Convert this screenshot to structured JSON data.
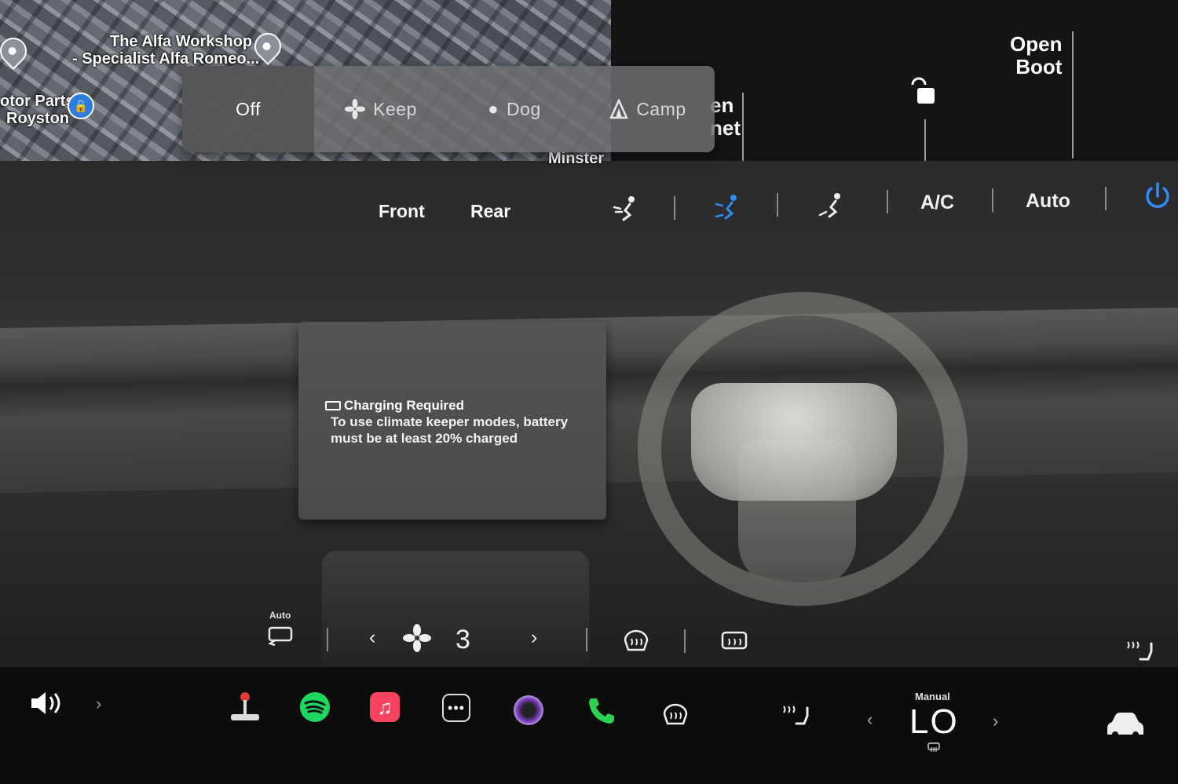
{
  "map": {
    "labels": [
      "The Alfa Workshop",
      "- Specialist Alfa Romeo...",
      "otor Parts",
      "Royston",
      "Minster"
    ]
  },
  "keeper_modes": {
    "options": [
      "Off",
      "Keep",
      "Dog",
      "Camp"
    ],
    "selected": "Off"
  },
  "top_right": {
    "open_frunk_partial": [
      "en",
      "net"
    ],
    "open_boot": [
      "Open",
      "Boot"
    ]
  },
  "climate": {
    "tabs": [
      "Front",
      "Rear"
    ],
    "ac_label": "A/C",
    "auto_label": "Auto",
    "active_color": "#2f8cf0",
    "alert_title": "Charging Required",
    "alert_message_1": "To use climate keeper modes, battery",
    "alert_message_2": "must be at least 20% charged",
    "recirc_mode_label": "Auto",
    "fan_speed": "3"
  },
  "dock": {
    "temperature_mode": "Manual",
    "temperature": "LO",
    "apps": [
      "volume-icon",
      "joystick-icon",
      "spotify-icon",
      "music-icon",
      "more-icon",
      "camera-icon",
      "phone-icon",
      "defrost-icon",
      "seat-heat-icon",
      "car-icon"
    ],
    "colors": {
      "spotify": "#1ed760",
      "music": "#f5425f",
      "phone": "#2bd14f"
    }
  }
}
